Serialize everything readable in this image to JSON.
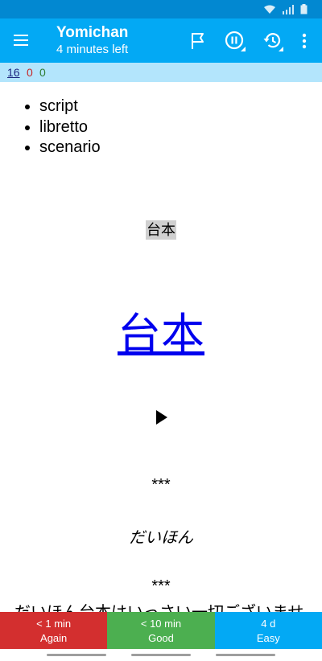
{
  "app_bar": {
    "title": "Yomichan",
    "subtitle": "4 minutes left",
    "icons": {
      "menu": "hamburger-menu-icon",
      "flag": "flag-icon",
      "pause": "pause-circle-icon",
      "undo": "history-undo-icon",
      "overflow": "more-vert-icon"
    }
  },
  "status_bar": {
    "icons": [
      "wifi-icon",
      "signal-icon",
      "battery-icon"
    ]
  },
  "counts": {
    "new": "16",
    "learn": "0",
    "review": "0"
  },
  "card": {
    "definitions": [
      "script",
      "libretto",
      "scenario"
    ],
    "term_small": "台本",
    "term_big": "台本",
    "separator": "***",
    "reading": "だいほん",
    "example": "だいほん台本はいっさい一切ございませ"
  },
  "answer_buttons": [
    {
      "interval": "< 1 min",
      "label": "Again"
    },
    {
      "interval": "< 10 min",
      "label": "Good"
    },
    {
      "interval": "4 d",
      "label": "Easy"
    }
  ],
  "colors": {
    "status_bar": "#0288d1",
    "app_bar": "#03a9f4",
    "counts_bar": "#b3e5fc",
    "again": "#d32f2f",
    "good": "#4caf50",
    "easy": "#03a9f4",
    "link": "#0000ee"
  }
}
